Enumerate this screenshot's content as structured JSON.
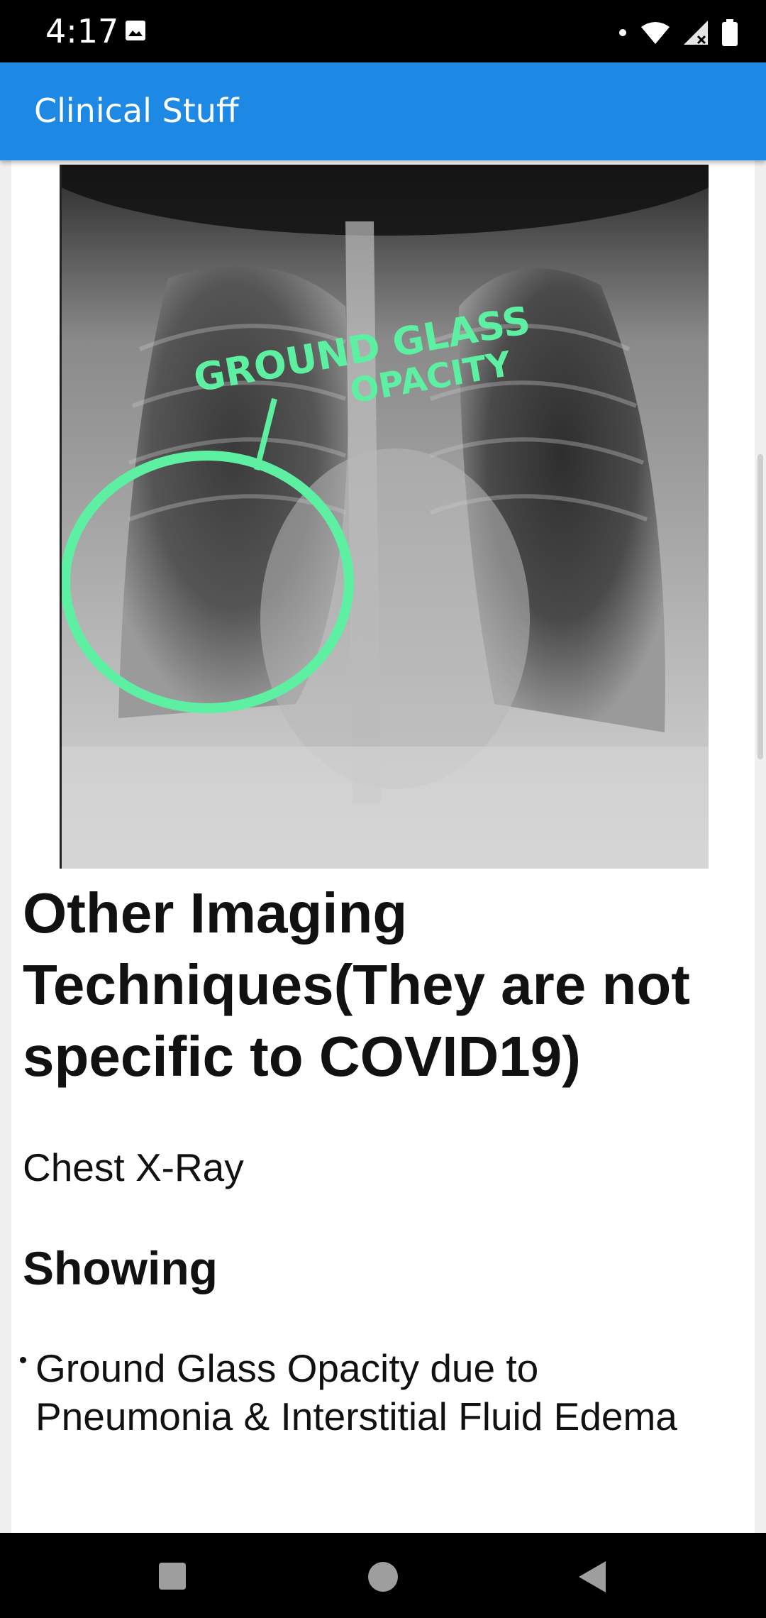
{
  "status_bar": {
    "time": "4:17"
  },
  "app_bar": {
    "title": "Clinical Stuff"
  },
  "image": {
    "annotation_line1": "GROUND GLASS",
    "annotation_line2": "OPACITY"
  },
  "article": {
    "heading": "Other Imaging Techniques(They are not specific to COVID19)",
    "paragraph": "Chest X-Ray",
    "subheading": "Showing",
    "bullets": [
      "Ground Glass Opacity due to Pneumonia & Interstitial Fluid Edema"
    ]
  },
  "colors": {
    "app_bar": "#1e88e5",
    "annotation": "#5ef0a2"
  },
  "icons": {
    "status": [
      "image-icon",
      "dot-icon",
      "wifi-icon",
      "signal-icon",
      "battery-icon"
    ],
    "nav": [
      "recents-square-icon",
      "home-circle-icon",
      "back-triangle-icon"
    ]
  }
}
